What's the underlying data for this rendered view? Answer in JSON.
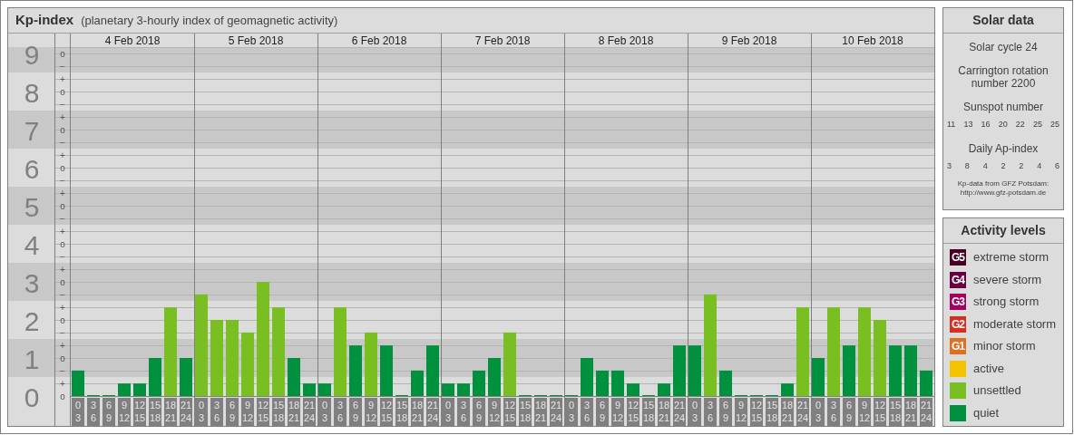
{
  "kp_panel": {
    "title": "Kp-index",
    "subtitle": "(planetary 3-hourly index of geomagnetic activity)",
    "days": [
      "4 Feb 2018",
      "5 Feb 2018",
      "6 Feb 2018",
      "7 Feb 2018",
      "8 Feb 2018",
      "9 Feb 2018",
      "10 Feb 2018"
    ],
    "chart_data": {
      "type": "bar",
      "categories": [
        "0\n3",
        "3\n6",
        "6\n9",
        "9\n12",
        "12\n15",
        "15\n18",
        "18\n21",
        "21\n24",
        "0\n3",
        "3\n6",
        "6\n9",
        "9\n12",
        "12\n15",
        "15\n18",
        "18\n21",
        "21\n24",
        "0\n3",
        "3\n6",
        "6\n9",
        "9\n12",
        "12\n15",
        "15\n18",
        "18\n21",
        "21\n24",
        "0\n3",
        "3\n6",
        "6\n9",
        "9\n12",
        "12\n15",
        "15\n18",
        "18\n21",
        "21\n24",
        "0\n3",
        "3\n6",
        "6\n9",
        "9\n12",
        "12\n15",
        "15\n18",
        "18\n21",
        "21\n24",
        "0\n3",
        "3\n6",
        "6\n9",
        "9\n12",
        "12\n15",
        "15\n18",
        "18\n21",
        "21\n24",
        "0\n3",
        "3\n6",
        "6\n9",
        "9\n12",
        "12\n15",
        "15\n18",
        "18\n21",
        "21\n24"
      ],
      "series": [
        {
          "color": "#00913f",
          "values": [
            0.67,
            0,
            0,
            0.33,
            0.33,
            1,
            null,
            1,
            null,
            null,
            null,
            null,
            null,
            null,
            1,
            0.33,
            0.33,
            null,
            1.33,
            null,
            1.33,
            0,
            0.67,
            1.33,
            0.33,
            0.33,
            0.67,
            1,
            null,
            0,
            0,
            0,
            0,
            1,
            0.67,
            0.67,
            0.33,
            0,
            0.33,
            1.33,
            1.33,
            null,
            0.67,
            0,
            0,
            0,
            0.33,
            null,
            1,
            null,
            1.33,
            null,
            null,
            1.33,
            1.33,
            0.67
          ]
        },
        {
          "color": "#7abf22",
          "values": [
            null,
            null,
            null,
            null,
            null,
            null,
            2.33,
            null,
            2.67,
            2,
            2,
            1.67,
            3,
            2.33,
            null,
            null,
            null,
            2.33,
            null,
            1.67,
            null,
            null,
            null,
            null,
            null,
            null,
            null,
            null,
            1.67,
            null,
            null,
            null,
            null,
            null,
            null,
            null,
            null,
            null,
            null,
            null,
            null,
            2.67,
            null,
            null,
            null,
            null,
            null,
            2.33,
            null,
            2.33,
            null,
            2.33,
            2,
            null,
            null,
            null
          ]
        }
      ],
      "ylim": [
        0,
        9
      ],
      "grid": true,
      "yticks": [
        0,
        1,
        2,
        3,
        4,
        5,
        6,
        7,
        8,
        9
      ]
    },
    "minor_ticks": [
      "o",
      "−",
      "+",
      "o",
      "−",
      "+",
      "o",
      "−",
      "+",
      "o",
      "−",
      "+",
      "o",
      "−",
      "+",
      "o",
      "−",
      "+",
      "o",
      "−",
      "+",
      "o",
      "−",
      "+",
      "o",
      "−",
      "+",
      "o"
    ]
  },
  "solar_data": {
    "title": "Solar data",
    "solar_cycle": "Solar cycle 24",
    "carrington": "Carrington rotation number 2200",
    "sunspot_label": "Sunspot number",
    "sunspot_numbers": [
      "11",
      "13",
      "16",
      "20",
      "22",
      "25",
      "25"
    ],
    "ap_label": "Daily Ap-index",
    "ap_values": [
      "3",
      "8",
      "4",
      "2",
      "2",
      "4",
      "6"
    ],
    "source": "Kp-data from GFZ Potsdam:",
    "source_url": "http://www.gfz-potsdam.de"
  },
  "activity_levels": {
    "title": "Activity levels",
    "items": [
      {
        "badge": "G5",
        "label": "extreme storm",
        "color": "#4a0020"
      },
      {
        "badge": "G4",
        "label": "severe storm",
        "color": "#6b0040"
      },
      {
        "badge": "G3",
        "label": "strong storm",
        "color": "#a8005e"
      },
      {
        "badge": "G2",
        "label": "moderate storm",
        "color": "#d92d1e"
      },
      {
        "badge": "G1",
        "label": "minor storm",
        "color": "#e07020"
      },
      {
        "label": "active",
        "color": "#f5c400"
      },
      {
        "label": "unsettled",
        "color": "#7abf22"
      },
      {
        "label": "quiet",
        "color": "#00913f"
      }
    ]
  }
}
